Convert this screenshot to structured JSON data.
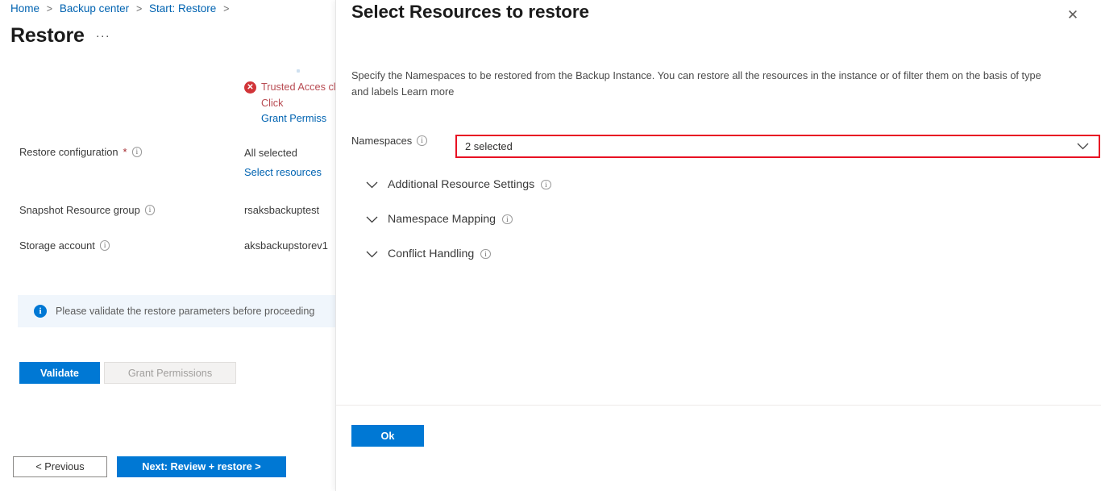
{
  "breadcrumb": {
    "items": [
      "Home",
      "Backup center",
      "Start: Restore"
    ],
    "separator": ">",
    "trailing_separator": ">"
  },
  "page": {
    "title": "Restore",
    "more_actions": "···"
  },
  "error": {
    "icon": "error-circle-icon",
    "line1": "Trusted Acces",
    "line2": "cluster. Click ",
    "link": "Grant Permiss",
    "color": "#b84b52",
    "icon_color": "#d13438"
  },
  "form": {
    "rows": [
      {
        "label": "Restore configuration",
        "required": true,
        "info": true,
        "value": "All selected",
        "link": "Select resources"
      },
      {
        "label": "Snapshot Resource group",
        "required": false,
        "info": true,
        "value": "rsaksbackuptest",
        "link": ""
      },
      {
        "label": "Storage account",
        "required": false,
        "info": true,
        "value": "aksbackupstorev1",
        "link": ""
      }
    ]
  },
  "info_banner": {
    "icon": "info-circle-icon",
    "text": "Please validate the restore parameters before proceeding",
    "background": "#f0f6fc",
    "icon_color": "#0078d4"
  },
  "actions": {
    "validate": "Validate",
    "grant_permissions": "Grant Permissions",
    "previous": "< Previous",
    "next": "Next: Review + restore >"
  },
  "panel": {
    "title": "Select Resources to restore",
    "close_icon": "close-icon",
    "description": "Specify the Namespaces to be restored from the Backup Instance. You can restore all the resources in the instance or of filter them on the basis of type and labels Learn more",
    "namespaces": {
      "label": "Namespaces",
      "info": true,
      "selected_value": "2 selected",
      "chevron_icon": "chevron-down-icon",
      "highlight_color": "#e81123"
    },
    "sections": [
      {
        "label": "Additional Resource Settings",
        "info": true,
        "chevron_icon": "chevron-down-icon",
        "expanded": false
      },
      {
        "label": "Namespace Mapping",
        "info": true,
        "chevron_icon": "chevron-down-icon",
        "expanded": false
      },
      {
        "label": "Conflict Handling",
        "info": true,
        "chevron_icon": "chevron-down-icon",
        "expanded": false
      }
    ],
    "ok_label": "Ok"
  },
  "colors": {
    "accent": "#0078d4",
    "link": "#0063b1",
    "error": "#e81123",
    "banner_bg": "#f0f6fc"
  }
}
